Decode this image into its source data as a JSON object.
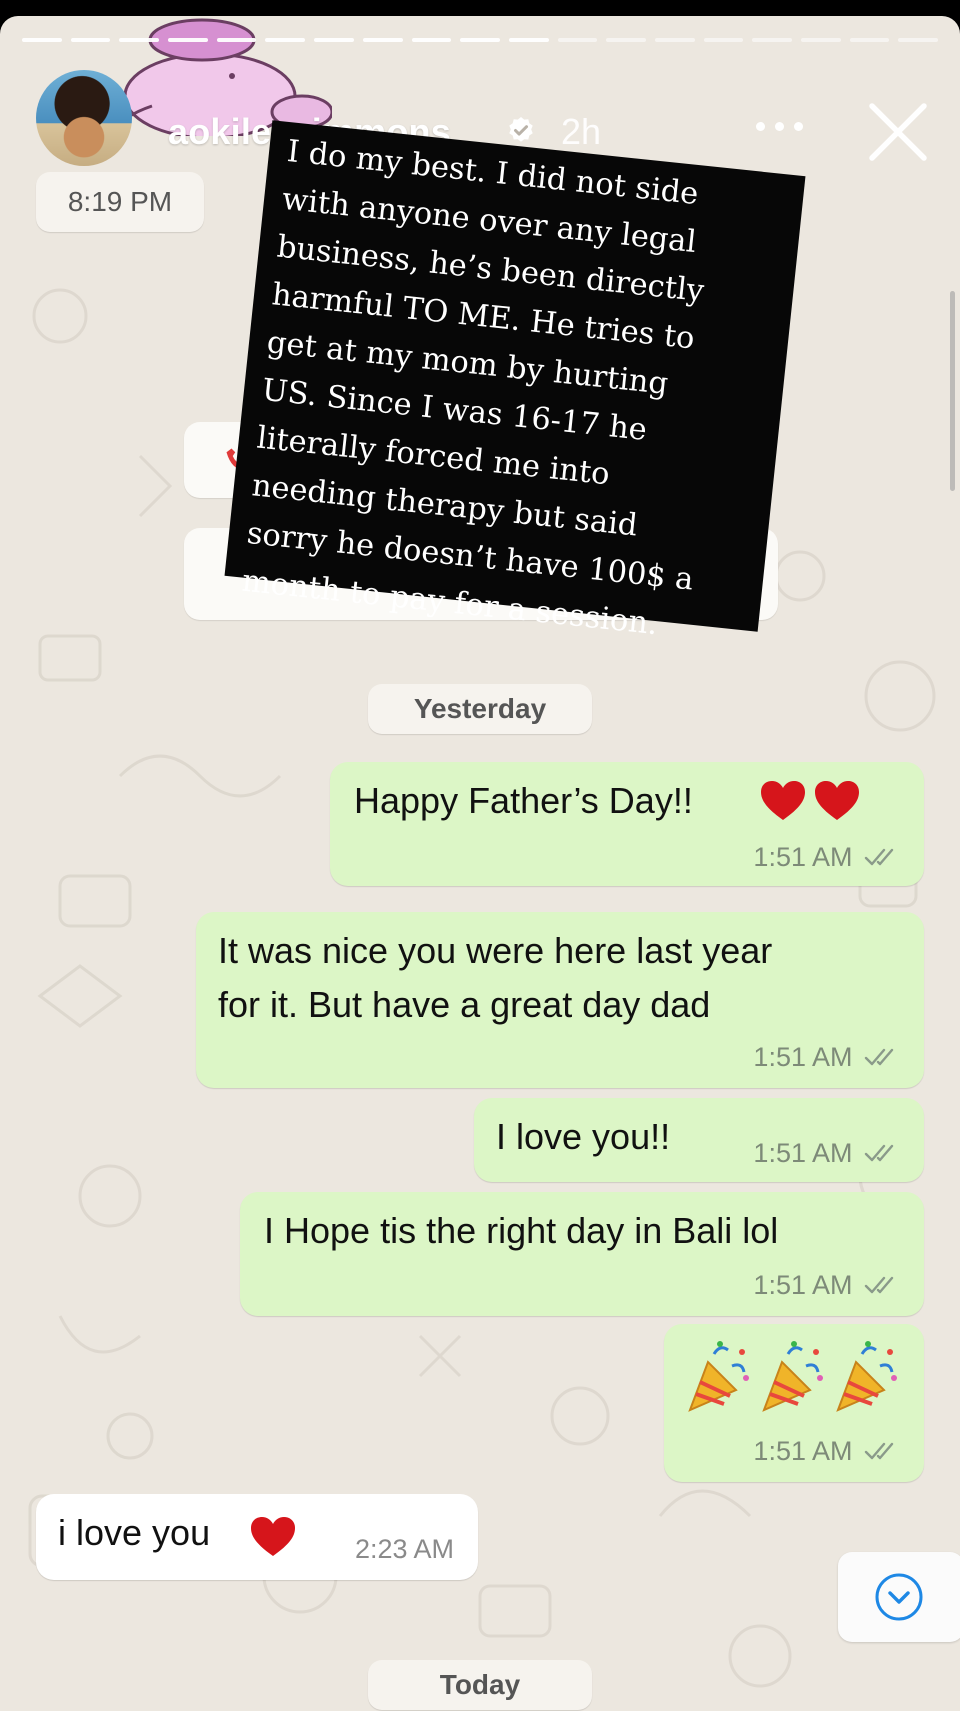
{
  "story": {
    "username": "aokileesimmons",
    "time_ago": "2h",
    "progress_segments": 19,
    "progress_done": 11,
    "icons": {
      "verified": "verified-badge-icon",
      "more": "more-dots-icon",
      "close": "close-icon"
    }
  },
  "chat": {
    "top_time_label": "8:19 PM",
    "date_yesterday": "Yesterday",
    "date_today": "Today",
    "messages": [
      {
        "text": "Happy Father’s Day!!",
        "time": "1:51 AM",
        "direction": "out",
        "emoji": "heart-emoji x2"
      },
      {
        "text_line1": "It was nice you were here last year",
        "text_line2": "for it. But have a great day dad",
        "time": "1:51 AM",
        "direction": "out"
      },
      {
        "text": "I love you!!",
        "time": "1:51 AM",
        "direction": "out"
      },
      {
        "text": "I Hope tis the right day in Bali lol",
        "time": "1:51 AM",
        "direction": "out"
      },
      {
        "text": "",
        "time": "1:51 AM",
        "direction": "out",
        "emoji": "party-popper-emoji x3"
      },
      {
        "text": "i love you",
        "time": "2:23 AM",
        "direction": "in",
        "emoji": "heart-emoji"
      }
    ]
  },
  "overlay": {
    "text": "I do my best. I did not side\nwith anyone over any legal\nbusiness, he’s been directly\nharmful TO ME. He tries to\nget at my mom by hurting\nUS. Since I was 16-17 he\nliterally forced me into\nneeding therapy but said\nsorry he doesn’t have 100$ a\nmonth to pay for a session."
  },
  "colors": {
    "chat_background": "#ece7df",
    "outgoing_bubble": "#dcf6c6",
    "incoming_bubble": "#ffffff",
    "overlay_card": "#070707",
    "read_ticks": "#8a9a8a",
    "scroll_button_icon": "#1e88e5"
  }
}
